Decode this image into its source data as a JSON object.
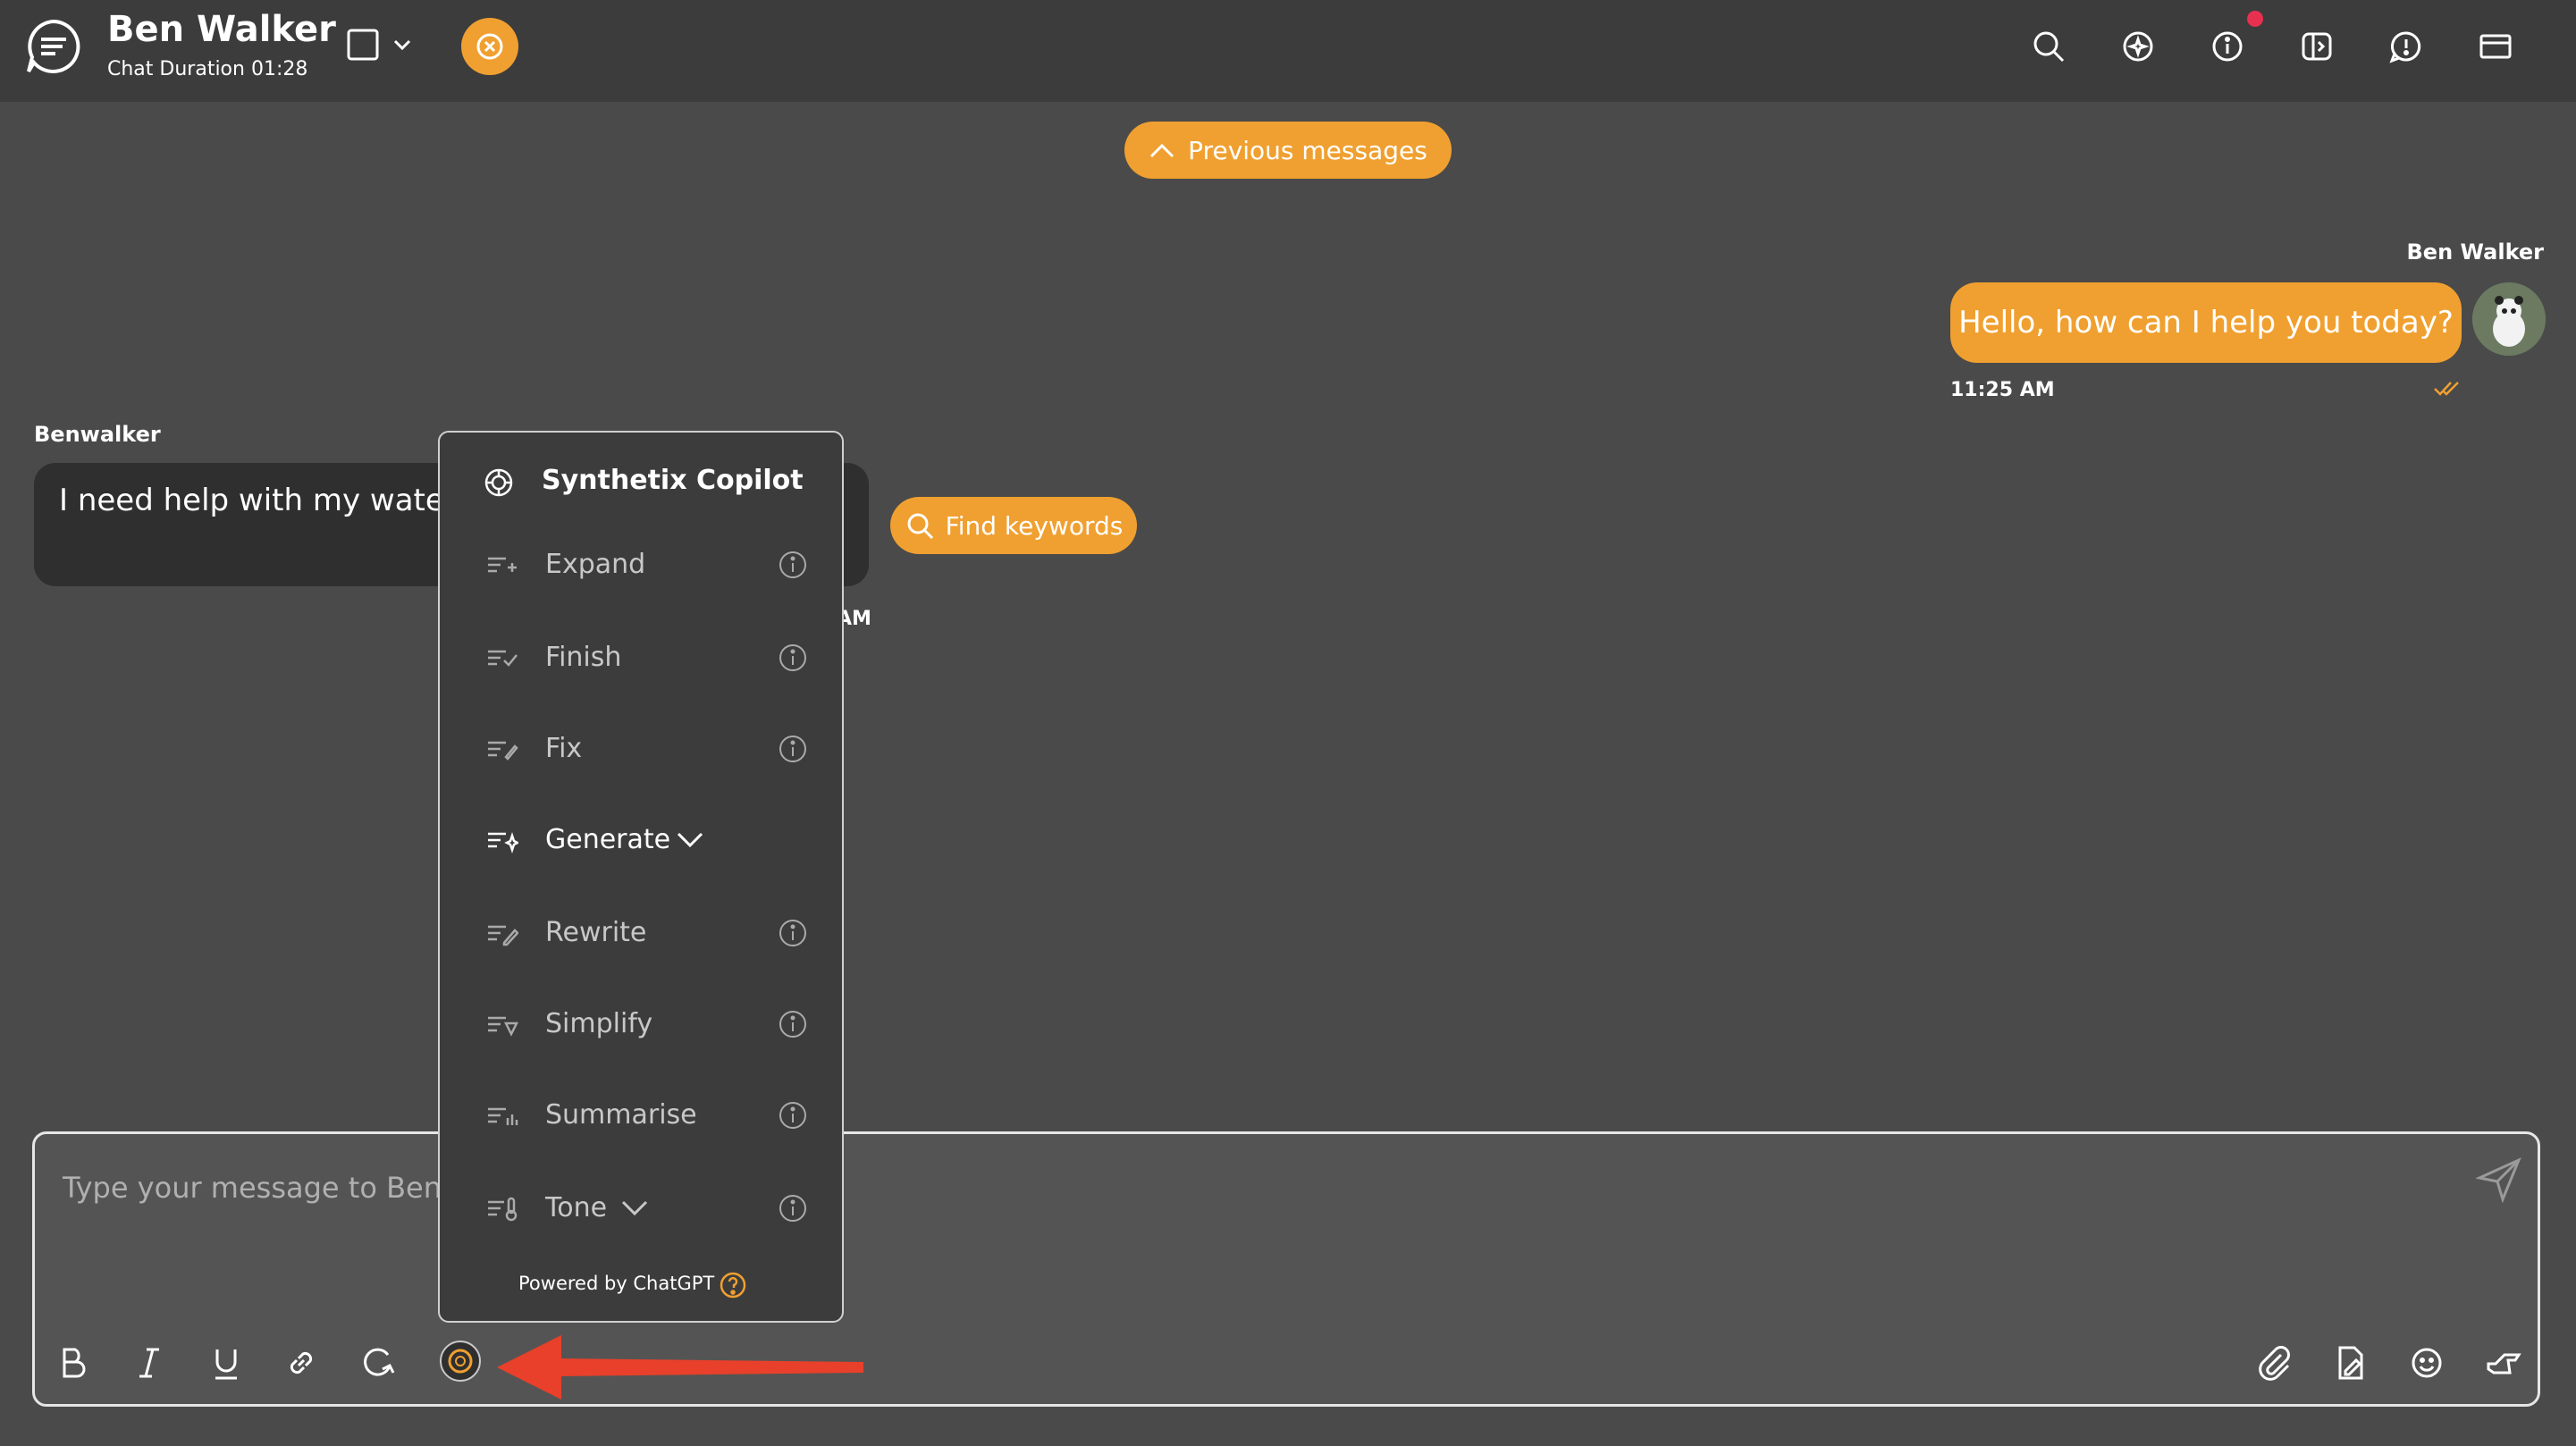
{
  "header": {
    "agent_name": "Ben Walker",
    "chat_duration": "Chat Duration 01:28",
    "icons": [
      "search-icon",
      "sparkle-chat-icon",
      "info-icon",
      "transfer-icon",
      "alert-icon",
      "card-icon"
    ]
  },
  "conversation": {
    "previous_messages_label": "Previous messages",
    "outgoing": {
      "sender": "Ben Walker",
      "text": "Hello, how can I help you today?",
      "time": "11:25 AM"
    },
    "incoming": {
      "sender": "Benwalker",
      "text": "I need help with my water s",
      "time_partial": "AM"
    },
    "find_keywords_label": "Find keywords"
  },
  "composer": {
    "placeholder": "Type your message to Ben"
  },
  "copilot": {
    "title": "Synthetix Copilot",
    "items": [
      {
        "label": "Expand"
      },
      {
        "label": "Finish"
      },
      {
        "label": "Fix"
      },
      {
        "label": "Generate"
      },
      {
        "label": "Rewrite"
      },
      {
        "label": "Simplify"
      },
      {
        "label": "Summarise"
      },
      {
        "label": "Tone"
      }
    ],
    "powered_by": "Powered by ChatGPT"
  },
  "colors": {
    "accent": "#f0a030",
    "header_bg": "#3c3c3c",
    "page_bg": "#4a4a4a",
    "alert_dot": "#e83050",
    "arrow": "#e8402a"
  }
}
